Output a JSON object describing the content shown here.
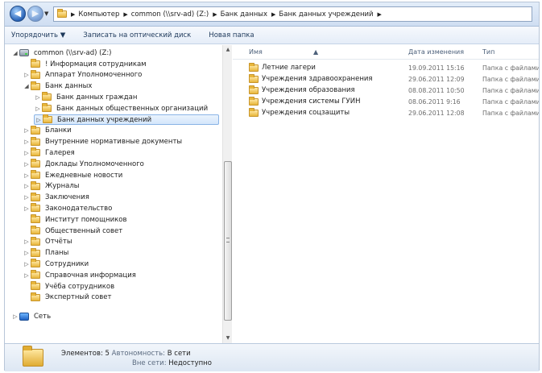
{
  "address": {
    "crumbs": [
      "Компьютер",
      "common (\\\\srv-ad) (Z:)",
      "Банк данных",
      "Банк данных учреждений"
    ]
  },
  "toolbar": {
    "organize": "Упорядочить ▼",
    "burn": "Записать на оптический диск",
    "new_folder": "Новая папка"
  },
  "tree": {
    "drive": "common (\\\\srv-ad) (Z:)",
    "items": [
      {
        "label": "! Информация сотрудникам",
        "level": 1,
        "arrow": ""
      },
      {
        "label": "Аппарат Уполномоченного",
        "level": 1,
        "arrow": "▷"
      },
      {
        "label": "Банк данных",
        "level": 1,
        "arrow": "◢"
      },
      {
        "label": "Банк данных граждан",
        "level": 2,
        "arrow": "▷"
      },
      {
        "label": "Банк данных общественных организаций",
        "level": 2,
        "arrow": "▷"
      },
      {
        "label": "Банк данных учреждений",
        "level": 2,
        "arrow": "▷",
        "selected": true
      },
      {
        "label": "Бланки",
        "level": 1,
        "arrow": "▷"
      },
      {
        "label": "Внутренние нормативные документы",
        "level": 1,
        "arrow": "▷"
      },
      {
        "label": "Галерея",
        "level": 1,
        "arrow": "▷"
      },
      {
        "label": "Доклады Уполномоченного",
        "level": 1,
        "arrow": "▷"
      },
      {
        "label": "Ежедневные новости",
        "level": 1,
        "arrow": "▷"
      },
      {
        "label": "Журналы",
        "level": 1,
        "arrow": "▷"
      },
      {
        "label": "Заключения",
        "level": 1,
        "arrow": "▷"
      },
      {
        "label": "Законодательство",
        "level": 1,
        "arrow": "▷"
      },
      {
        "label": "Институт помощников",
        "level": 1,
        "arrow": ""
      },
      {
        "label": "Общественный совет",
        "level": 1,
        "arrow": ""
      },
      {
        "label": "Отчёты",
        "level": 1,
        "arrow": "▷"
      },
      {
        "label": "Планы",
        "level": 1,
        "arrow": "▷"
      },
      {
        "label": "Сотрудники",
        "level": 1,
        "arrow": "▷"
      },
      {
        "label": "Справочная информация",
        "level": 1,
        "arrow": "▷"
      },
      {
        "label": "Учёба сотрудников",
        "level": 1,
        "arrow": ""
      },
      {
        "label": "Экспертный совет",
        "level": 1,
        "arrow": ""
      }
    ],
    "network": "Сеть"
  },
  "columns": {
    "name": "Имя",
    "date": "Дата изменения",
    "type": "Тип"
  },
  "files": [
    {
      "name": "Летние лагери",
      "date": "19.09.2011 15:16",
      "type": "Папка с файлами"
    },
    {
      "name": "Учреждения здравоохранения",
      "date": "29.06.2011 12:09",
      "type": "Папка с файлами"
    },
    {
      "name": "Учреждения образования",
      "date": "08.08.2011 10:50",
      "type": "Папка с файлами"
    },
    {
      "name": "Учреждения системы ГУИН",
      "date": "08.06.2011 9:16",
      "type": "Папка с файлами"
    },
    {
      "name": "Учреждения соцзащиты",
      "date": "29.06.2011 12:08",
      "type": "Папка с файлами"
    }
  ],
  "details": {
    "count_label": "Элементов: 5",
    "offline_label": "Автономность:",
    "offline_value": "В сети",
    "unavailable_label": "Вне сети:",
    "unavailable_value": "Недоступно"
  }
}
